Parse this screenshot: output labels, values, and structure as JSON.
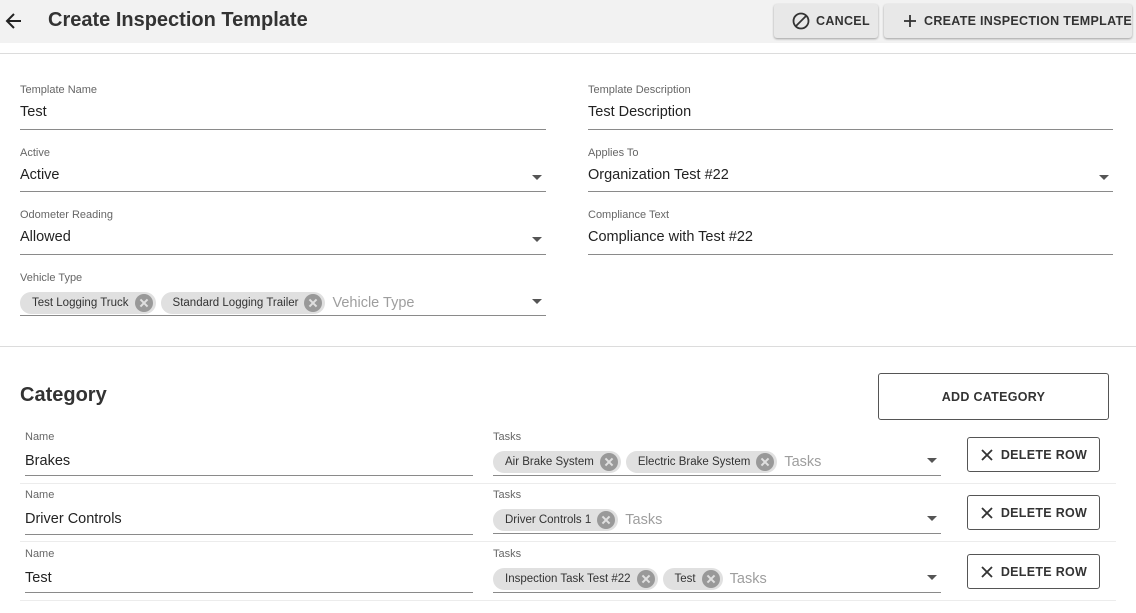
{
  "header": {
    "title": "Create Inspection Template",
    "cancel_label": "CANCEL",
    "create_label": "CREATE INSPECTION TEMPLATE"
  },
  "form": {
    "template_name": {
      "label": "Template Name",
      "value": "Test"
    },
    "template_description": {
      "label": "Template Description",
      "value": "Test Description"
    },
    "active": {
      "label": "Active",
      "value": "Active"
    },
    "applies_to": {
      "label": "Applies To",
      "value": "Organization Test #22"
    },
    "odometer_reading": {
      "label": "Odometer Reading",
      "value": "Allowed"
    },
    "compliance_text": {
      "label": "Compliance Text",
      "value": "Compliance with Test #22"
    },
    "vehicle_type": {
      "label": "Vehicle Type",
      "chips": [
        "Test Logging Truck",
        "Standard Logging Trailer"
      ],
      "placeholder": "Vehicle Type"
    }
  },
  "category": {
    "title": "Category",
    "add_label": "ADD CATEGORY",
    "rows": [
      {
        "name_label": "Name",
        "name": "Brakes",
        "tasks_label": "Tasks",
        "tasks": [
          "Air Brake System",
          "Electric Brake System"
        ],
        "tasks_placeholder": "Tasks",
        "delete_label": "DELETE ROW"
      },
      {
        "name_label": "Name",
        "name": "Driver Controls",
        "tasks_label": "Tasks",
        "tasks": [
          "Driver Controls 1"
        ],
        "tasks_placeholder": "Tasks",
        "delete_label": "DELETE ROW"
      },
      {
        "name_label": "Name",
        "name": "Test",
        "tasks_label": "Tasks",
        "tasks": [
          "Inspection Task Test #22",
          "Test"
        ],
        "tasks_placeholder": "Tasks",
        "delete_label": "DELETE ROW"
      }
    ]
  }
}
